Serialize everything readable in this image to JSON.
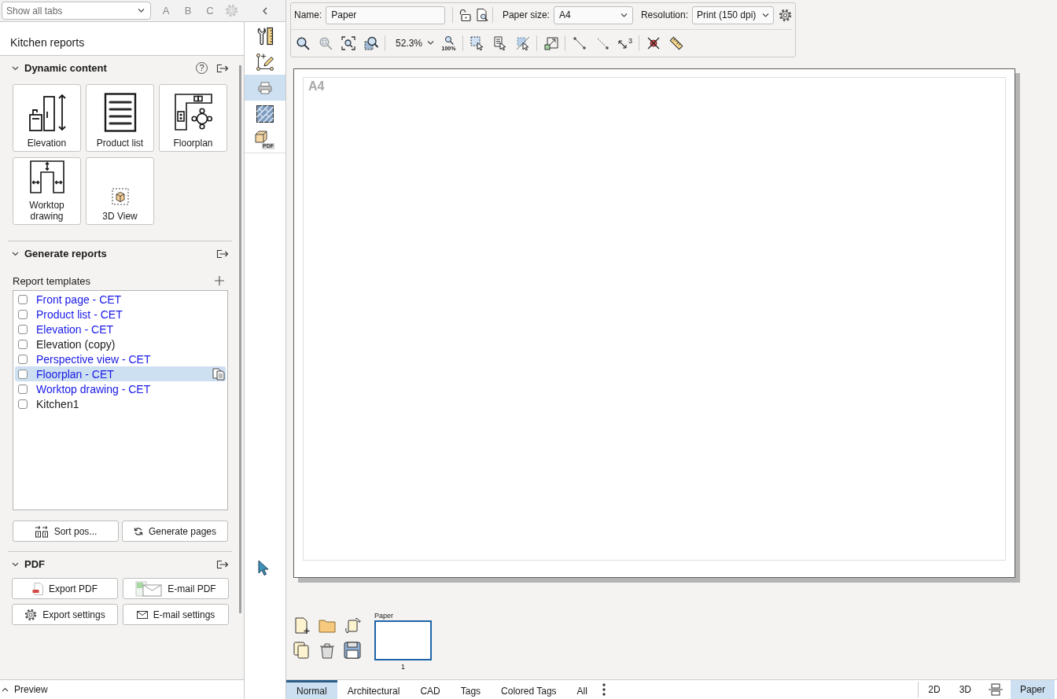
{
  "top_bar": {
    "tab_filter": {
      "value": "Show all tabs"
    },
    "letters": [
      "A",
      "B",
      "C"
    ],
    "settings": {
      "disabled": true
    }
  },
  "side_tools": [
    {
      "kind": "wrench-ruler",
      "selected": false
    },
    {
      "kind": "node-pencil",
      "selected": false
    },
    {
      "kind": "printer",
      "selected": true
    },
    {
      "kind": "tiles",
      "selected": false
    },
    {
      "kind": "pdf-box",
      "label": "PDF",
      "selected": false
    }
  ],
  "sidebar": {
    "title": "Kitchen reports",
    "dynamic_content": {
      "title": "Dynamic content",
      "expanded": true,
      "help": "?",
      "tiles": [
        {
          "kind": "elevation",
          "label": "Elevation"
        },
        {
          "kind": "product-list",
          "label": "Product list"
        },
        {
          "kind": "floorplan",
          "label": "Floorplan"
        },
        {
          "kind": "worktop",
          "label": "Worktop drawing"
        },
        {
          "kind": "view-3d",
          "label": "3D View"
        }
      ]
    },
    "generate_reports": {
      "title": "Generate reports",
      "expanded": true,
      "list_title": "Report templates",
      "templates": [
        {
          "label": "Front page - CET",
          "kind": "builtin",
          "checked": false,
          "selected": false
        },
        {
          "label": "Product list - CET",
          "kind": "builtin",
          "checked": false,
          "selected": false
        },
        {
          "label": "Elevation - CET",
          "kind": "builtin",
          "checked": false,
          "selected": false
        },
        {
          "label": "Elevation (copy)",
          "kind": "custom",
          "checked": false,
          "selected": false
        },
        {
          "label": "Perspective view - CET",
          "kind": "builtin",
          "checked": false,
          "selected": false
        },
        {
          "label": "Floorplan - CET",
          "kind": "builtin",
          "checked": false,
          "selected": true
        },
        {
          "label": "Worktop drawing - CET",
          "kind": "builtin",
          "checked": false,
          "selected": false
        },
        {
          "label": "Kitchen1",
          "kind": "custom",
          "checked": false,
          "selected": false
        }
      ],
      "buttons": [
        {
          "kind": "sort",
          "label": "Sort pos..."
        },
        {
          "kind": "refresh",
          "label": "Generate pages"
        }
      ]
    },
    "pdf": {
      "title": "PDF",
      "expanded": true,
      "buttons": [
        {
          "kind": "pdf-file",
          "label": "Export PDF"
        },
        {
          "kind": "mail-pdf",
          "label": "E-mail PDF"
        },
        {
          "kind": "gear",
          "label": "Export settings"
        },
        {
          "kind": "envelope",
          "label": "E-mail settings"
        }
      ]
    },
    "preview": {
      "title": "Preview",
      "expanded": false
    }
  },
  "toolbar": {
    "name": {
      "label": "Name:",
      "value": "Paper"
    },
    "paper_size": {
      "label": "Paper size:",
      "value": "A4"
    },
    "resolution": {
      "label": "Resolution:",
      "value": "Print (150 dpi)"
    },
    "tool_groups": [
      {
        "tools": [
          {
            "kind": "zoom-in",
            "disabled": false
          },
          {
            "kind": "zoom-selection",
            "disabled": true
          },
          {
            "kind": "zoom-extents",
            "disabled": false
          },
          {
            "kind": "zoom-window",
            "disabled": false
          }
        ]
      },
      {
        "tools": [
          {
            "kind": "zoom-level",
            "value": "52.3%",
            "disabled": false
          },
          {
            "kind": "zoom-actual",
            "label": "100%",
            "disabled": false
          }
        ]
      },
      {
        "tools": [
          {
            "kind": "select-area",
            "disabled": false
          },
          {
            "kind": "select-list",
            "disabled": false
          },
          {
            "kind": "deselect",
            "disabled": false
          }
        ]
      },
      {
        "tools": [
          {
            "kind": "frame",
            "disabled": false
          }
        ]
      },
      {
        "tools": [
          {
            "kind": "line",
            "disabled": false
          },
          {
            "kind": "dashed-line",
            "disabled": false
          },
          {
            "kind": "dimension",
            "label": "3",
            "disabled": false
          }
        ]
      },
      {
        "tools": [
          {
            "kind": "delete",
            "disabled": false
          },
          {
            "kind": "ruler",
            "disabled": false
          }
        ]
      }
    ]
  },
  "canvas": {
    "page_label": "A4"
  },
  "pages": {
    "thumbnails": [
      {
        "title": "Paper",
        "number": "1",
        "selected": true
      }
    ]
  },
  "bottom_bar": {
    "layers": [
      {
        "label": "Normal",
        "selected": true
      },
      {
        "label": "Architectural",
        "selected": false
      },
      {
        "label": "CAD",
        "selected": false
      },
      {
        "label": "Tags",
        "selected": false
      },
      {
        "label": "Colored Tags",
        "selected": false
      },
      {
        "label": "All",
        "selected": false
      }
    ],
    "views": [
      {
        "kind": "text",
        "label": "2D",
        "selected": false
      },
      {
        "kind": "text",
        "label": "3D",
        "selected": false
      },
      {
        "kind": "split",
        "selected": false
      },
      {
        "kind": "text",
        "label": "Paper",
        "selected": true
      }
    ]
  }
}
